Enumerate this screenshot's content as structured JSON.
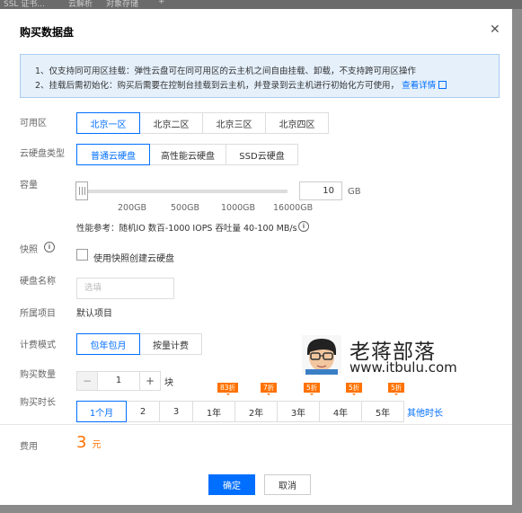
{
  "background": {
    "items": [
      "SSL 证书...",
      "云解析",
      "对象存储",
      "+"
    ]
  },
  "dialog": {
    "title": "购买数据盘",
    "close_icon": "close-icon"
  },
  "notice": {
    "line1": "1、仅支持同可用区挂载：弹性云盘可在同可用区的云主机之间自由挂载、卸载，不支持跨可用区操作",
    "line2": "2、挂载后需初始化：购买后需要在控制台挂载到云主机，并登录到云主机进行初始化方可使用，",
    "line2_link": "查看详情"
  },
  "zone": {
    "label": "可用区",
    "options": [
      "北京一区",
      "北京二区",
      "北京三区",
      "北京四区"
    ],
    "selected": "北京一区"
  },
  "disk_type": {
    "label": "云硬盘类型",
    "options": [
      "普通云硬盘",
      "高性能云硬盘",
      "SSD云硬盘"
    ],
    "selected": "普通云硬盘"
  },
  "capacity": {
    "label": "容量",
    "ticks": [
      "200GB",
      "500GB",
      "1000GB",
      "16000GB"
    ],
    "value": "10",
    "unit": "GB",
    "perf_text": "性能参考：随机IO 数百-1000 IOPS 吞吐量 40-100 MB/s"
  },
  "snapshot": {
    "label": "快照",
    "checkbox_label": "使用快照创建云硬盘",
    "checked": false
  },
  "disk_name": {
    "label": "硬盘名称",
    "placeholder": "选填"
  },
  "project": {
    "label": "所属项目",
    "value": "默认项目"
  },
  "billing": {
    "label": "计费模式",
    "options": [
      "包年包月",
      "按量计费"
    ],
    "selected": "包年包月"
  },
  "quantity": {
    "label": "购买数量",
    "value": "1",
    "unit": "块",
    "minus": "−",
    "plus": "+"
  },
  "duration": {
    "label": "购买时长",
    "options": [
      "1个月",
      "2",
      "3",
      "1年",
      "2年",
      "3年",
      "4年",
      "5年"
    ],
    "selected": "1个月",
    "badges": [
      "83折",
      "7折",
      "5折",
      "5折",
      "5折"
    ],
    "more_link": "其他时长"
  },
  "fee": {
    "label": "费用",
    "amount": "3",
    "currency": "元"
  },
  "footer": {
    "confirm": "确定",
    "cancel": "取消"
  },
  "watermark": {
    "title": "老蒋部落",
    "url": "www.itbulu.com"
  },
  "colors": {
    "accent": "#006eff",
    "price": "#ff7200",
    "notice_bg": "#e5f0fb"
  }
}
